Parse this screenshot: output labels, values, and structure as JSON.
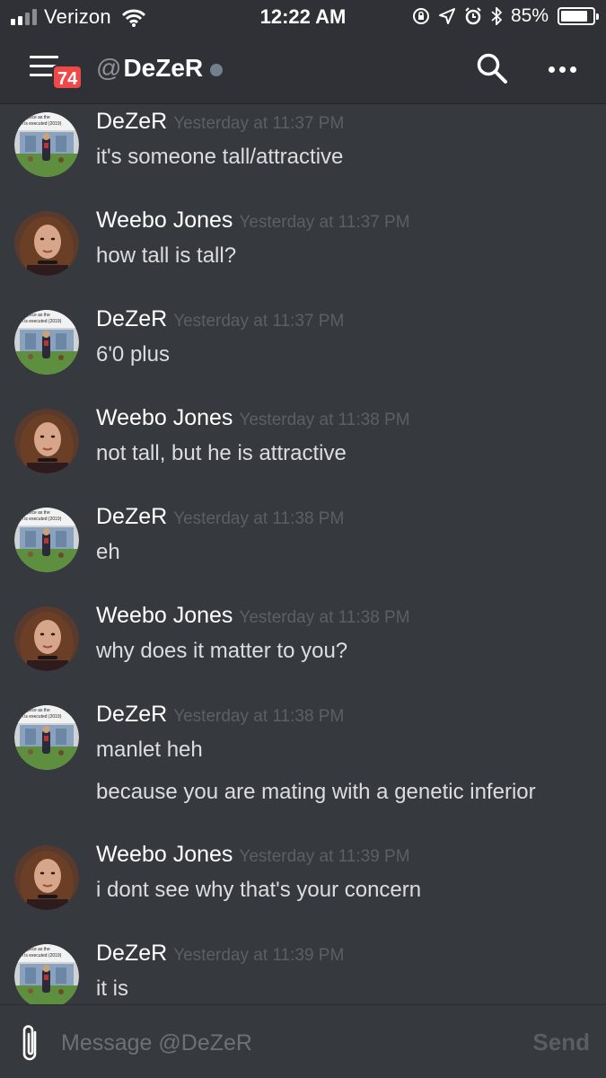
{
  "status_bar": {
    "carrier": "Verizon",
    "time": "12:22 AM",
    "battery_percent": "85%",
    "battery_level": 0.85,
    "icons": [
      "signal-icon",
      "wifi-icon",
      "rotation-lock-icon",
      "location-icon",
      "alarm-icon",
      "bluetooth-icon",
      "battery-icon"
    ]
  },
  "header": {
    "menu_icon": "hamburger-icon",
    "notification_count": "74",
    "at": "@",
    "channel_name": "DeZeR",
    "presence": "offline",
    "search_icon": "search-icon",
    "more_icon": "ellipsis-icon"
  },
  "messages": [
    {
      "author": "DeZeR",
      "avatar": "dezer",
      "timestamp": "Yesterday at 11:37 PM",
      "lines": [
        "it's someone tall/attractive"
      ]
    },
    {
      "author": "Weebo Jones",
      "avatar": "weebo",
      "timestamp": "Yesterday at 11:37 PM",
      "lines": [
        "how tall is tall?"
      ]
    },
    {
      "author": "DeZeR",
      "avatar": "dezer",
      "timestamp": "Yesterday at 11:37 PM",
      "lines": [
        "6'0 plus"
      ]
    },
    {
      "author": "Weebo Jones",
      "avatar": "weebo",
      "timestamp": "Yesterday at 11:38 PM",
      "lines": [
        "not tall, but he is attractive"
      ]
    },
    {
      "author": "DeZeR",
      "avatar": "dezer",
      "timestamp": "Yesterday at 11:38 PM",
      "lines": [
        "eh"
      ]
    },
    {
      "author": "Weebo Jones",
      "avatar": "weebo",
      "timestamp": "Yesterday at 11:38 PM",
      "lines": [
        "why does it matter to you?"
      ]
    },
    {
      "author": "DeZeR",
      "avatar": "dezer",
      "timestamp": "Yesterday at 11:38 PM",
      "lines": [
        "manlet heh",
        "because you are mating with a genetic inferior"
      ]
    },
    {
      "author": "Weebo Jones",
      "avatar": "weebo",
      "timestamp": "Yesterday at 11:39 PM",
      "lines": [
        "i dont see why that's your concern"
      ]
    },
    {
      "author": "DeZeR",
      "avatar": "dezer",
      "timestamp": "Yesterday at 11:39 PM",
      "lines": [
        "it is"
      ]
    }
  ],
  "avatars": {
    "dezer": {
      "caption_1": "rejoice as the",
      "caption_2": "rth is executed (2019)"
    }
  },
  "composer": {
    "attach_icon": "paperclip-icon",
    "placeholder": "Message @DeZeR",
    "send_label": "Send"
  },
  "colors": {
    "background": "#36393e",
    "header": "#2f3136",
    "badge": "#f04747",
    "timestamp": "#5c5f64",
    "message_text": "#dcddde"
  }
}
